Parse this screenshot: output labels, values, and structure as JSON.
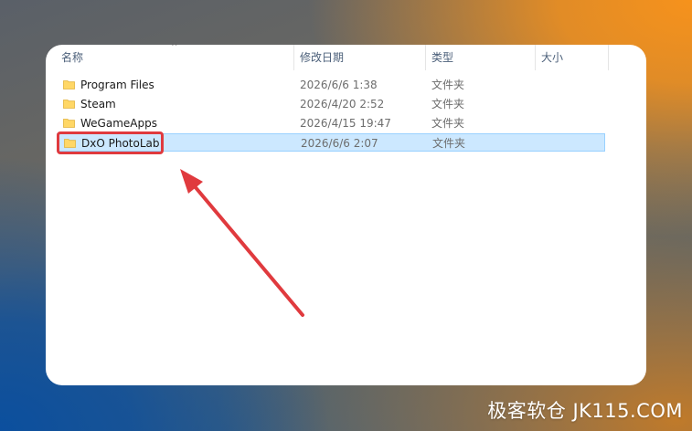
{
  "columns": {
    "name": "名称",
    "date": "修改日期",
    "type": "类型",
    "size": "大小"
  },
  "sort_indicator": "^",
  "files": [
    {
      "name": "Program Files",
      "date": "2026/6/6 1:38",
      "type": "文件夹",
      "icon": "folder-icon",
      "selected": false
    },
    {
      "name": "Steam",
      "date": "2026/4/20 2:52",
      "type": "文件夹",
      "icon": "folder-icon",
      "selected": false
    },
    {
      "name": "WeGameApps",
      "date": "2026/4/15 19:47",
      "type": "文件夹",
      "icon": "folder-icon",
      "selected": false
    },
    {
      "name": "DxO PhotoLab",
      "date": "2026/6/6 2:07",
      "type": "文件夹",
      "icon": "folder-icon",
      "selected": true
    }
  ],
  "annotation": {
    "highlight_color": "#e03a3e",
    "arrow_color": "#e03a3e"
  },
  "watermark": "极客软仓 JK115.COM",
  "colors": {
    "selection_fill": "#cce8ff",
    "selection_border": "#99d1ff",
    "folder_yellow": "#ffd766",
    "header_text": "#4c607a"
  }
}
